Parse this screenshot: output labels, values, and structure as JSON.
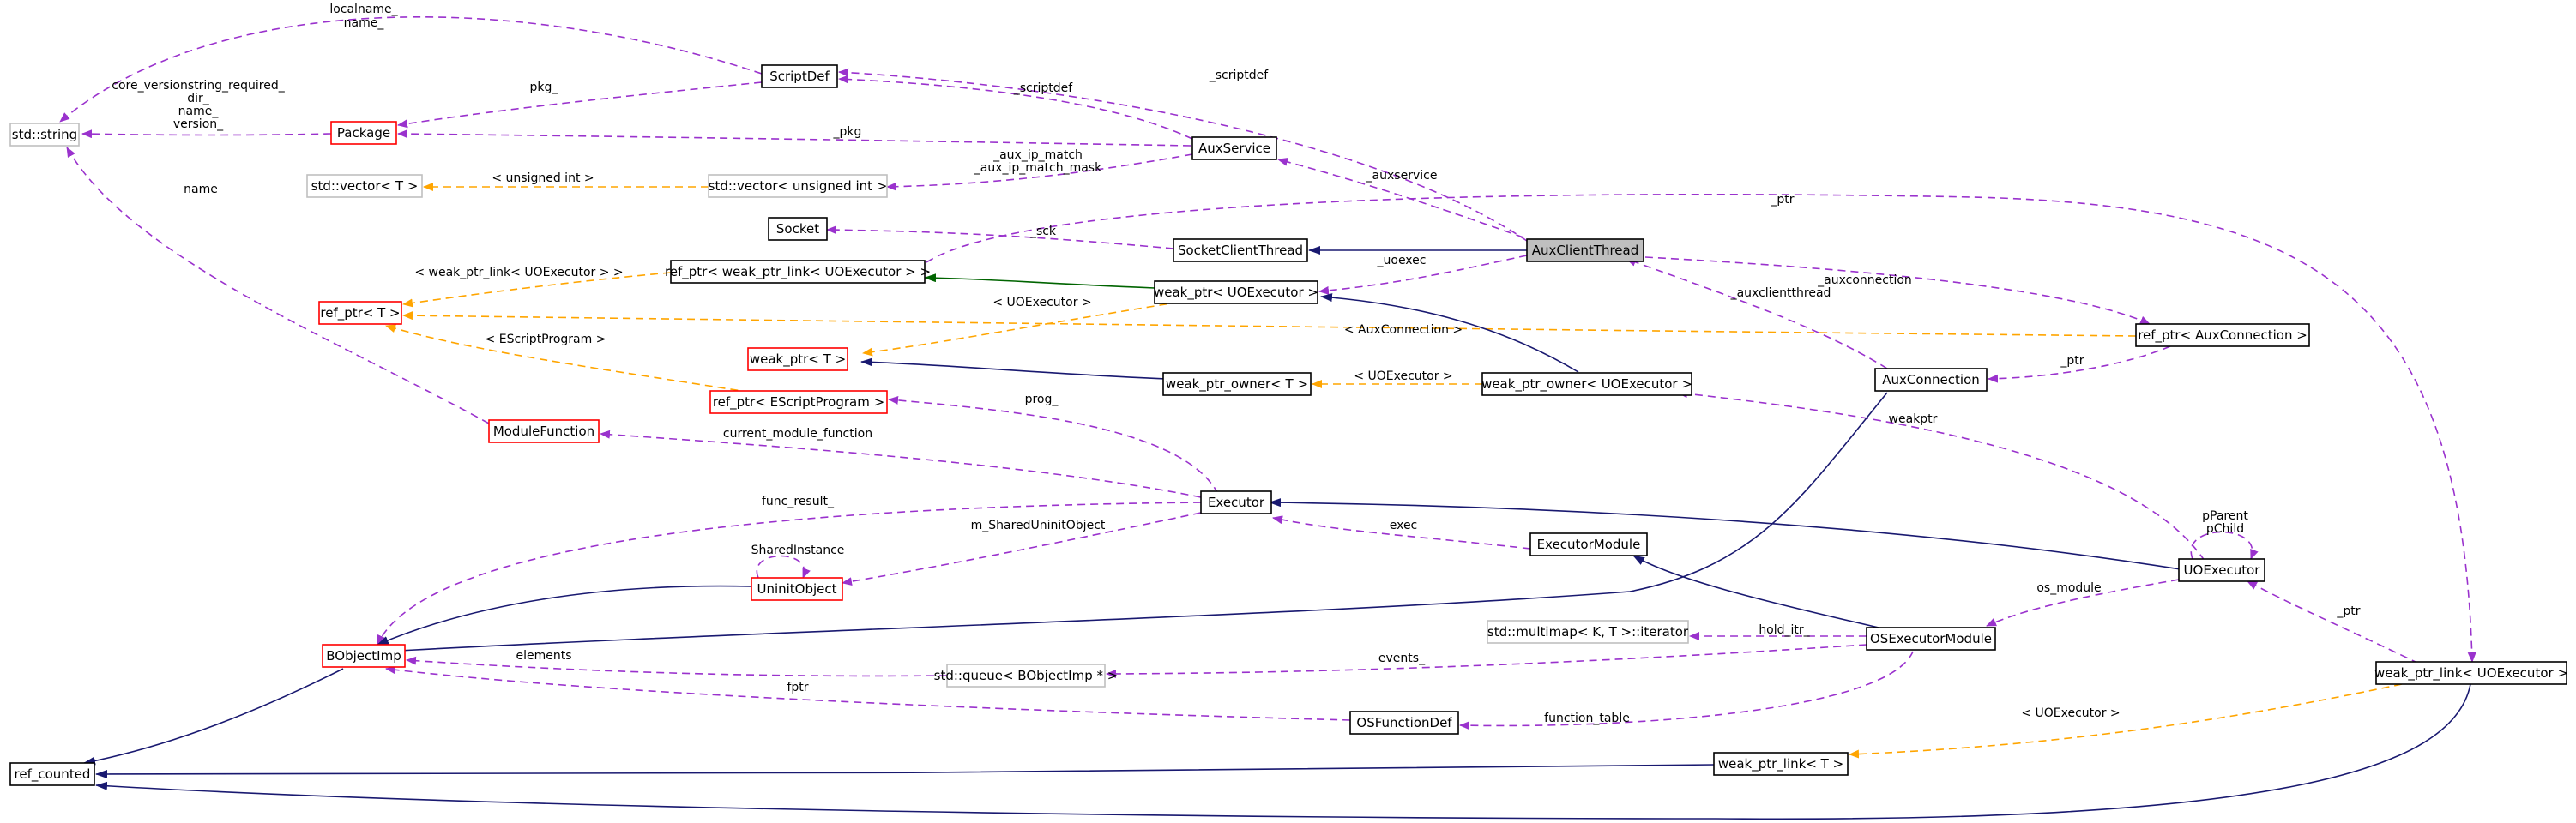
{
  "nodes": {
    "std_string": "std::string",
    "package": "Package",
    "scriptdef": "ScriptDef",
    "std_vector_t": "std::vector< T >",
    "std_vector_uint": "std::vector< unsigned int >",
    "auxservice": "AuxService",
    "socket": "Socket",
    "socketclientthread": "SocketClientThread",
    "auxclientthread": "AuxClientThread",
    "refptr_weakptrlink": "ref_ptr< weak_ptr_link< UOExecutor > >",
    "refptr_t": "ref_ptr< T >",
    "weakptr_uoexec": "weak_ptr< UOExecutor >",
    "refptr_auxconn": "ref_ptr< AuxConnection >",
    "weakptr_t": "weak_ptr< T >",
    "weakptrowner_t": "weak_ptr_owner< T >",
    "weakptrowner_uoexec": "weak_ptr_owner< UOExecutor >",
    "auxconnection": "AuxConnection",
    "refptr_escript": "ref_ptr< EScriptProgram >",
    "modulefunction": "ModuleFunction",
    "executor": "Executor",
    "executormodule": "ExecutorModule",
    "uoexecutor": "UOExecutor",
    "uninitobject": "UninitObject",
    "multimap_iter": "std::multimap< K, T >::iterator",
    "osexecutormodule": "OSExecutorModule",
    "bobjectimp": "BObjectImp",
    "queue_bobj": "std::queue< BObjectImp * >",
    "weakptrlink_uoexec": "weak_ptr_link< UOExecutor >",
    "osfunctiondef": "OSFunctionDef",
    "refcounted": "ref_counted",
    "weakptrlink_t": "weak_ptr_link< T >"
  },
  "edge_labels": {
    "localname": "localname_",
    "name1": "name_",
    "pkg_": "pkg_",
    "core_version": "core_versionstring_required_",
    "dir": "dir_",
    "name2": "name_",
    "version": "version_",
    "name3": "name",
    "scriptdef1": "_scriptdef",
    "scriptdef2": "_scriptdef",
    "pkg": "_pkg",
    "aux_ip_match": "_aux_ip_match",
    "aux_ip_match_mask": "_aux_ip_match_mask",
    "unsigned_int": "< unsigned int >",
    "auxservice": "_auxservice",
    "sck": "_sck",
    "ptr1": "_ptr",
    "uoexec": "_uoexec",
    "weakptrlink_tmpl": "< weak_ptr_link< UOExecutor > >",
    "uoexecutor_tmpl1": "< UOExecutor >",
    "auxclientthread": "_auxclientthread",
    "auxconnection_e": "_auxconnection",
    "auxconnection_tmpl": "< AuxConnection >",
    "escript_tmpl": "< EScriptProgram >",
    "ptr2": "_ptr",
    "uoexecutor_tmpl2": "< UOExecutor >",
    "prog": "prog_",
    "weakptr": "weakptr",
    "current_module_function": "current_module_function",
    "func_result": "func_result_",
    "pparent": "pParent",
    "pchild": "pChild",
    "sharedinstance": "SharedInstance",
    "m_sharedUninit": "m_SharedUninitObject",
    "exec": "exec",
    "os_module": "os_module",
    "hold_itr": "hold_itr_",
    "ptr3": "_ptr",
    "elements": "elements",
    "events": "events_",
    "fptr": "fptr",
    "function_table": "function_table",
    "uoexecutor_tmpl3": "< UOExecutor >"
  },
  "colors": {
    "member_edge": "#9a32cd",
    "template_edge": "#ffa500",
    "inheritance_edge": "#191970",
    "protected_inheritance_edge": "#006400",
    "highlight_fill": "#bfbfbf",
    "undocumented_border": "#ff0000",
    "external_border": "#bfbfbf"
  }
}
